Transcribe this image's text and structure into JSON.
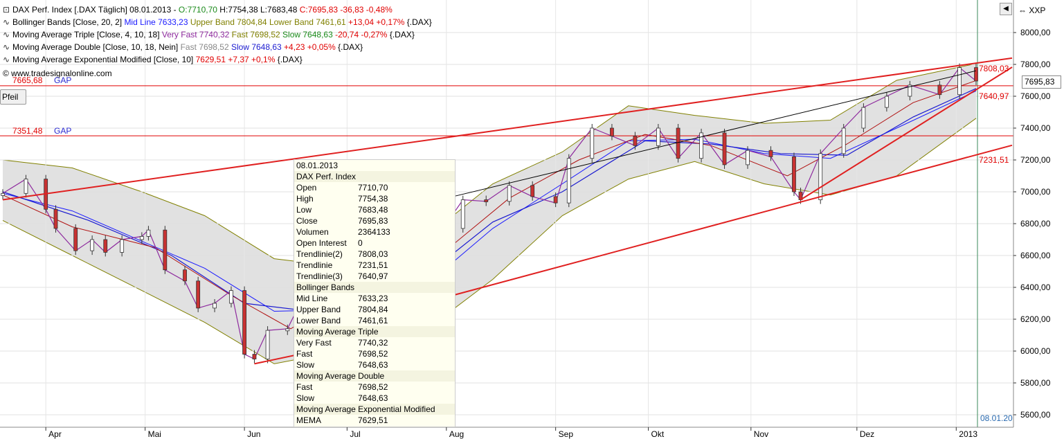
{
  "header": {
    "line1": {
      "title": "DAX Perf. Index [.DAX  Täglich] 08.01.2013 - ",
      "o": "O:7710,70",
      "h": " H:7754,38",
      "l": " L:7683,48",
      "c": " C:7695,83 -36,83 -0,48%"
    },
    "line2": {
      "name": "Bollinger Bands [Close, 20, 2] ",
      "mid": "Mid Line 7633,23 ",
      "upper": "Upper Band 7804,84 ",
      "lower": "Lower Band 7461,61 ",
      "chg": "+13,04 +0,17% ",
      "sym": "{.DAX}"
    },
    "line3": {
      "name": "Moving Average Triple [Close, 4, 10, 18] ",
      "vf": "Very Fast 7740,32 ",
      "fast": "Fast 7698,52 ",
      "slow": "Slow 7648,63 ",
      "chg": "-20,74 -0,27% ",
      "sym": "{.DAX}"
    },
    "line4": {
      "name": "Moving Average Double [Close, 10, 18, Nein] ",
      "fast": "Fast 7698,52 ",
      "slow": "Slow 7648,63 ",
      "chg": "+4,23 +0,05% ",
      "sym": "{.DAX}"
    },
    "line5": {
      "name": "Moving Average Exponential Modified [Close, 10] ",
      "val": "7629,51 ",
      "chg": "+7,37 +0,1% ",
      "sym": "{.DAX}"
    },
    "watermark": "© www.tradesignalonline.com"
  },
  "tags": {
    "gap1_val": "7665,68",
    "gap1_lbl": "GAP",
    "gap2_val": "7351,48",
    "gap2_lbl": "GAP",
    "t1": "7808,03",
    "t2": "7640,97",
    "t3": "7231,51"
  },
  "toolbar": {
    "pfeil": "Pfeil",
    "xxp": "XXP",
    "current_price": "7695,83",
    "last_date": "08.01.20"
  },
  "legend": [
    {
      "k": "08.01.2013",
      "v": "",
      "alt": false
    },
    {
      "k": "DAX Perf. Index",
      "v": "",
      "alt": true
    },
    {
      "k": "Open",
      "v": "7710,70",
      "alt": false
    },
    {
      "k": "High",
      "v": "7754,38",
      "alt": false
    },
    {
      "k": "Low",
      "v": "7683,48",
      "alt": false
    },
    {
      "k": "Close",
      "v": "7695,83",
      "alt": false
    },
    {
      "k": "Volumen",
      "v": "2364133",
      "alt": false
    },
    {
      "k": "Open Interest",
      "v": "0",
      "alt": false
    },
    {
      "k": "Trendlinie(2)",
      "v": "7808,03",
      "alt": false
    },
    {
      "k": "Trendlinie",
      "v": "7231,51",
      "alt": false
    },
    {
      "k": "Trendlinie(3)",
      "v": "7640,97",
      "alt": false
    },
    {
      "k": "Bollinger Bands",
      "v": "",
      "alt": true
    },
    {
      "k": "Mid Line",
      "v": "7633,23",
      "alt": false
    },
    {
      "k": "Upper Band",
      "v": "7804,84",
      "alt": false
    },
    {
      "k": "Lower Band",
      "v": "7461,61",
      "alt": false
    },
    {
      "k": "Moving Average Triple",
      "v": "",
      "alt": true
    },
    {
      "k": "Very Fast",
      "v": "7740,32",
      "alt": false
    },
    {
      "k": "Fast",
      "v": "7698,52",
      "alt": false
    },
    {
      "k": "Slow",
      "v": "7648,63",
      "alt": false
    },
    {
      "k": "Moving Average Double",
      "v": "",
      "alt": true
    },
    {
      "k": "Fast",
      "v": "7698,52",
      "alt": false
    },
    {
      "k": "Slow",
      "v": "7648,63",
      "alt": false
    },
    {
      "k": "Moving Average Exponential Modified",
      "v": "",
      "alt": true
    },
    {
      "k": "MEMA",
      "v": "7629,51",
      "alt": false
    }
  ],
  "chart_data": {
    "type": "line",
    "title": "DAX Perf. Index [.DAX  Täglich] 08.01.2013",
    "ylim": [
      5550,
      8150
    ],
    "y_ticks": [
      8000,
      7800,
      7600,
      7400,
      7200,
      7000,
      6800,
      6600,
      6400,
      6200,
      6000,
      5800,
      5600
    ],
    "y_tick_labels": [
      "8000,00",
      "7800,00",
      "7600,00",
      "7400,00",
      "7200,00",
      "7000,00",
      "6800,00",
      "6600,00",
      "6400,00",
      "6200,00",
      "6000,00",
      "5800,00",
      "5600,00"
    ],
    "x_tick_labels": [
      "Apr",
      "Mai",
      "Jun",
      "Jul",
      "Aug",
      "Sep",
      "Okt",
      "Nov",
      "Dez",
      "2013"
    ],
    "x_tick_dates": [
      "2012-04-02",
      "2012-05-02",
      "2012-06-01",
      "2012-07-02",
      "2012-08-01",
      "2012-09-03",
      "2012-10-01",
      "2012-11-01",
      "2012-12-03",
      "2013-01-02"
    ],
    "horizontal_levels": [
      7665.68,
      7351.48
    ],
    "trendlines": [
      {
        "name": "Trendlinie(2)",
        "from": [
          "2012-03-20",
          6950
        ],
        "to": [
          "2013-01-08",
          7808.03
        ]
      },
      {
        "name": "Trendlinie",
        "from": [
          "2012-07-25",
          6300
        ],
        "to": [
          "2013-01-08",
          7231.51
        ]
      },
      {
        "name": "Trendlinie(3)",
        "from": [
          "2012-11-16",
          6950
        ],
        "to": [
          "2013-01-08",
          7640.97
        ]
      },
      {
        "name": "",
        "from": [
          "2012-06-04",
          5920
        ],
        "to": [
          "2012-06-29",
          6030
        ]
      }
    ],
    "close": [
      [
        "2012-03-20",
        6990
      ],
      [
        "2012-03-27",
        7080
      ],
      [
        "2012-04-02",
        6890
      ],
      [
        "2012-04-05",
        6770
      ],
      [
        "2012-04-11",
        6630
      ],
      [
        "2012-04-16",
        6700
      ],
      [
        "2012-04-20",
        6620
      ],
      [
        "2012-04-25",
        6700
      ],
      [
        "2012-05-01",
        6720
      ],
      [
        "2012-05-03",
        6760
      ],
      [
        "2012-05-08",
        6510
      ],
      [
        "2012-05-14",
        6440
      ],
      [
        "2012-05-18",
        6270
      ],
      [
        "2012-05-23",
        6300
      ],
      [
        "2012-05-28",
        6380
      ],
      [
        "2012-06-01",
        5980
      ],
      [
        "2012-06-04",
        5950
      ],
      [
        "2012-06-08",
        6130
      ],
      [
        "2012-06-14",
        6140
      ],
      [
        "2012-06-20",
        6390
      ],
      [
        "2012-06-28",
        6150
      ],
      [
        "2012-07-03",
        6590
      ],
      [
        "2012-07-10",
        6430
      ],
      [
        "2012-07-17",
        6600
      ],
      [
        "2012-07-25",
        6420
      ],
      [
        "2012-07-31",
        6770
      ],
      [
        "2012-08-06",
        6950
      ],
      [
        "2012-08-13",
        6940
      ],
      [
        "2012-08-20",
        7040
      ],
      [
        "2012-08-27",
        6970
      ],
      [
        "2012-09-03",
        6930
      ],
      [
        "2012-09-07",
        7210
      ],
      [
        "2012-09-14",
        7400
      ],
      [
        "2012-09-20",
        7350
      ],
      [
        "2012-09-27",
        7290
      ],
      [
        "2012-10-04",
        7400
      ],
      [
        "2012-10-10",
        7210
      ],
      [
        "2012-10-17",
        7370
      ],
      [
        "2012-10-24",
        7170
      ],
      [
        "2012-10-31",
        7260
      ],
      [
        "2012-11-07",
        7220
      ],
      [
        "2012-11-14",
        7000
      ],
      [
        "2012-11-16",
        6950
      ],
      [
        "2012-11-22",
        7240
      ],
      [
        "2012-11-29",
        7400
      ],
      [
        "2012-12-05",
        7530
      ],
      [
        "2012-12-12",
        7600
      ],
      [
        "2012-12-19",
        7670
      ],
      [
        "2012-12-28",
        7610
      ],
      [
        "2013-01-03",
        7780
      ],
      [
        "2013-01-08",
        7695.83
      ]
    ],
    "bollinger_upper": [
      [
        "2012-03-20",
        7200
      ],
      [
        "2012-04-10",
        7150
      ],
      [
        "2012-05-01",
        7000
      ],
      [
        "2012-05-20",
        6850
      ],
      [
        "2012-06-10",
        6580
      ],
      [
        "2012-06-30",
        6530
      ],
      [
        "2012-07-25",
        6700
      ],
      [
        "2012-08-15",
        7050
      ],
      [
        "2012-09-05",
        7250
      ],
      [
        "2012-09-25",
        7540
      ],
      [
        "2012-10-15",
        7480
      ],
      [
        "2012-11-05",
        7430
      ],
      [
        "2012-11-25",
        7450
      ],
      [
        "2012-12-15",
        7700
      ],
      [
        "2013-01-08",
        7804.84
      ]
    ],
    "bollinger_lower": [
      [
        "2012-03-20",
        6820
      ],
      [
        "2012-04-10",
        6600
      ],
      [
        "2012-05-01",
        6380
      ],
      [
        "2012-05-20",
        6180
      ],
      [
        "2012-06-10",
        5920
      ],
      [
        "2012-06-30",
        6000
      ],
      [
        "2012-07-25",
        6120
      ],
      [
        "2012-08-15",
        6450
      ],
      [
        "2012-09-05",
        6850
      ],
      [
        "2012-09-25",
        7080
      ],
      [
        "2012-10-15",
        7190
      ],
      [
        "2012-11-05",
        7050
      ],
      [
        "2012-11-25",
        6980
      ],
      [
        "2012-12-15",
        7100
      ],
      [
        "2013-01-08",
        7461.61
      ]
    ],
    "mid_line": [
      [
        "2012-03-20",
        6990
      ],
      [
        "2012-04-10",
        6880
      ],
      [
        "2012-05-01",
        6690
      ],
      [
        "2012-05-20",
        6520
      ],
      [
        "2012-06-10",
        6250
      ],
      [
        "2012-06-30",
        6260
      ],
      [
        "2012-07-25",
        6400
      ],
      [
        "2012-08-15",
        6770
      ],
      [
        "2012-09-05",
        7050
      ],
      [
        "2012-09-25",
        7320
      ],
      [
        "2012-10-15",
        7330
      ],
      [
        "2012-11-05",
        7240
      ],
      [
        "2012-11-25",
        7210
      ],
      [
        "2012-12-15",
        7400
      ],
      [
        "2013-01-08",
        7633.23
      ]
    ],
    "ma_slow": [
      [
        "2012-03-20",
        7000
      ],
      [
        "2012-04-15",
        6820
      ],
      [
        "2012-05-10",
        6600
      ],
      [
        "2012-06-01",
        6300
      ],
      [
        "2012-06-25",
        6240
      ],
      [
        "2012-07-20",
        6380
      ],
      [
        "2012-08-15",
        6810
      ],
      [
        "2012-09-05",
        7000
      ],
      [
        "2012-09-30",
        7320
      ],
      [
        "2012-10-20",
        7300
      ],
      [
        "2012-11-10",
        7240
      ],
      [
        "2012-11-30",
        7230
      ],
      [
        "2012-12-20",
        7470
      ],
      [
        "2013-01-08",
        7648.63
      ]
    ],
    "ma_fast": [
      [
        "2012-03-20",
        6980
      ],
      [
        "2012-04-10",
        6780
      ],
      [
        "2012-05-05",
        6650
      ],
      [
        "2012-05-28",
        6350
      ],
      [
        "2012-06-15",
        6140
      ],
      [
        "2012-07-05",
        6400
      ],
      [
        "2012-07-30",
        6600
      ],
      [
        "2012-08-20",
        6960
      ],
      [
        "2012-09-10",
        7200
      ],
      [
        "2012-09-30",
        7360
      ],
      [
        "2012-10-20",
        7290
      ],
      [
        "2012-11-12",
        7100
      ],
      [
        "2012-11-30",
        7300
      ],
      [
        "2012-12-20",
        7560
      ],
      [
        "2013-01-08",
        7698.52
      ]
    ]
  }
}
